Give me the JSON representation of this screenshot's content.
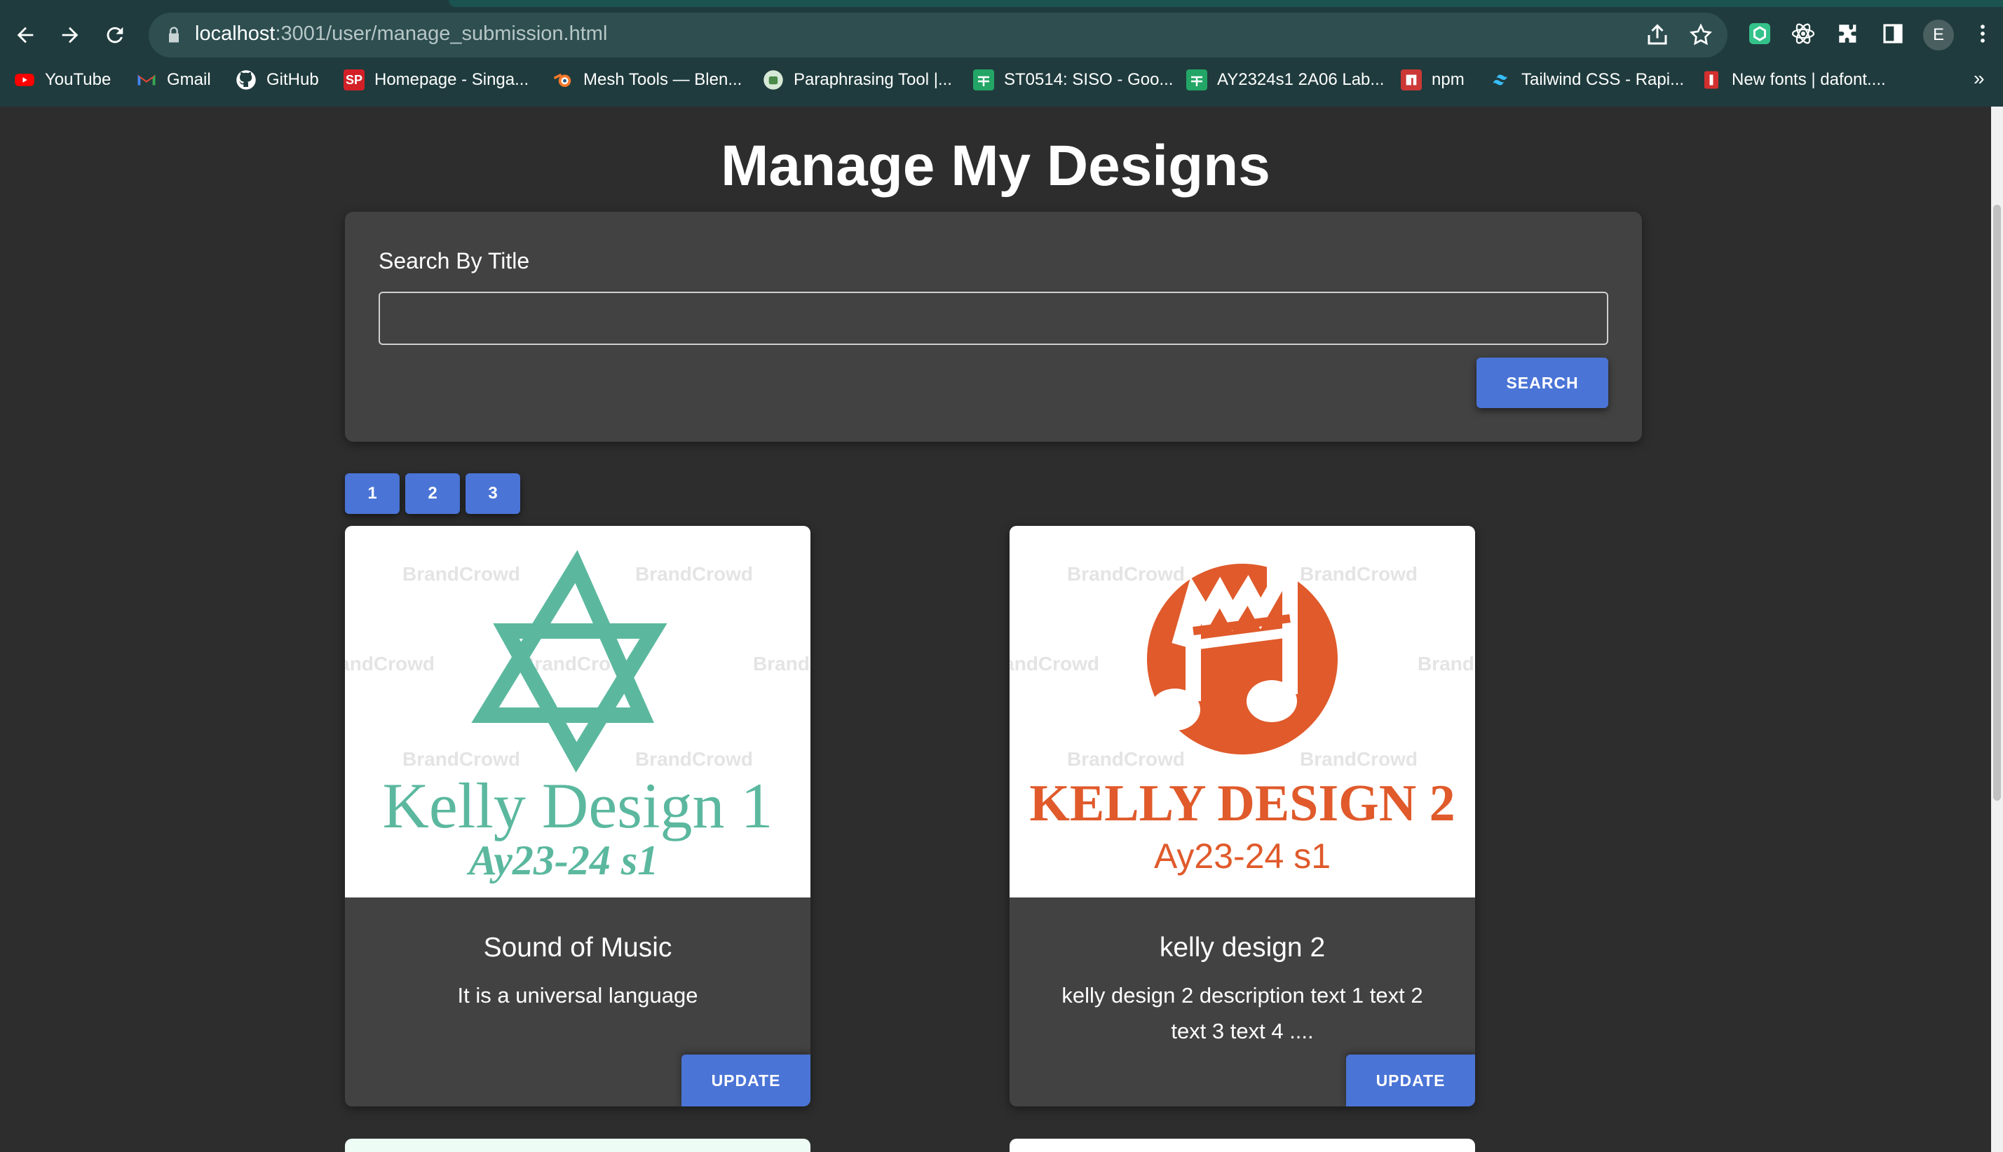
{
  "browser": {
    "url_host": "localhost",
    "url_path": ":3001/user/manage_submission.html",
    "profile_initial": "E",
    "bookmarks": [
      {
        "label": "YouTube",
        "icon": "youtube-icon"
      },
      {
        "label": "Gmail",
        "icon": "gmail-icon"
      },
      {
        "label": "GitHub",
        "icon": "github-icon"
      },
      {
        "label": "Homepage - Singa...",
        "icon": "sp-icon"
      },
      {
        "label": "Mesh Tools — Blen...",
        "icon": "blender-icon"
      },
      {
        "label": "Paraphrasing Tool |...",
        "icon": "quillbot-icon"
      },
      {
        "label": "ST0514: SISO - Goo...",
        "icon": "sheets-icon"
      },
      {
        "label": "AY2324s1 2A06 Lab...",
        "icon": "sheets-icon"
      },
      {
        "label": "npm",
        "icon": "npm-icon"
      },
      {
        "label": "Tailwind CSS - Rapi...",
        "icon": "tailwind-icon"
      },
      {
        "label": "New fonts | dafont....",
        "icon": "dafont-icon"
      }
    ],
    "more": "»"
  },
  "page": {
    "title": "Manage My Designs",
    "search": {
      "label": "Search By Title",
      "value": "",
      "placeholder": "",
      "button": "SEARCH"
    },
    "pagination": [
      "1",
      "2",
      "3"
    ],
    "cards": [
      {
        "title": "Sound of Music",
        "description": "It is a universal language",
        "button": "UPDATE",
        "image": {
          "logo_line1": "Kelly  Design  1",
          "logo_line2": "Ay23-24 s1",
          "watermark": "BrandCrowd",
          "color": "#5bb89f"
        }
      },
      {
        "title": "kelly design 2",
        "description": "kelly design 2 description text 1 text 2 text 3 text 4 ....",
        "button": "UPDATE",
        "image": {
          "logo_line1": "KELLY DESIGN 2",
          "logo_line2": "Ay23-24 s1",
          "watermark": "BrandCrowd",
          "color": "#e05a2b"
        }
      }
    ]
  },
  "colors": {
    "background": "#2d2d2d",
    "card": "#424242",
    "accent": "#4a74d6",
    "chrome": "#1f3b3d"
  }
}
